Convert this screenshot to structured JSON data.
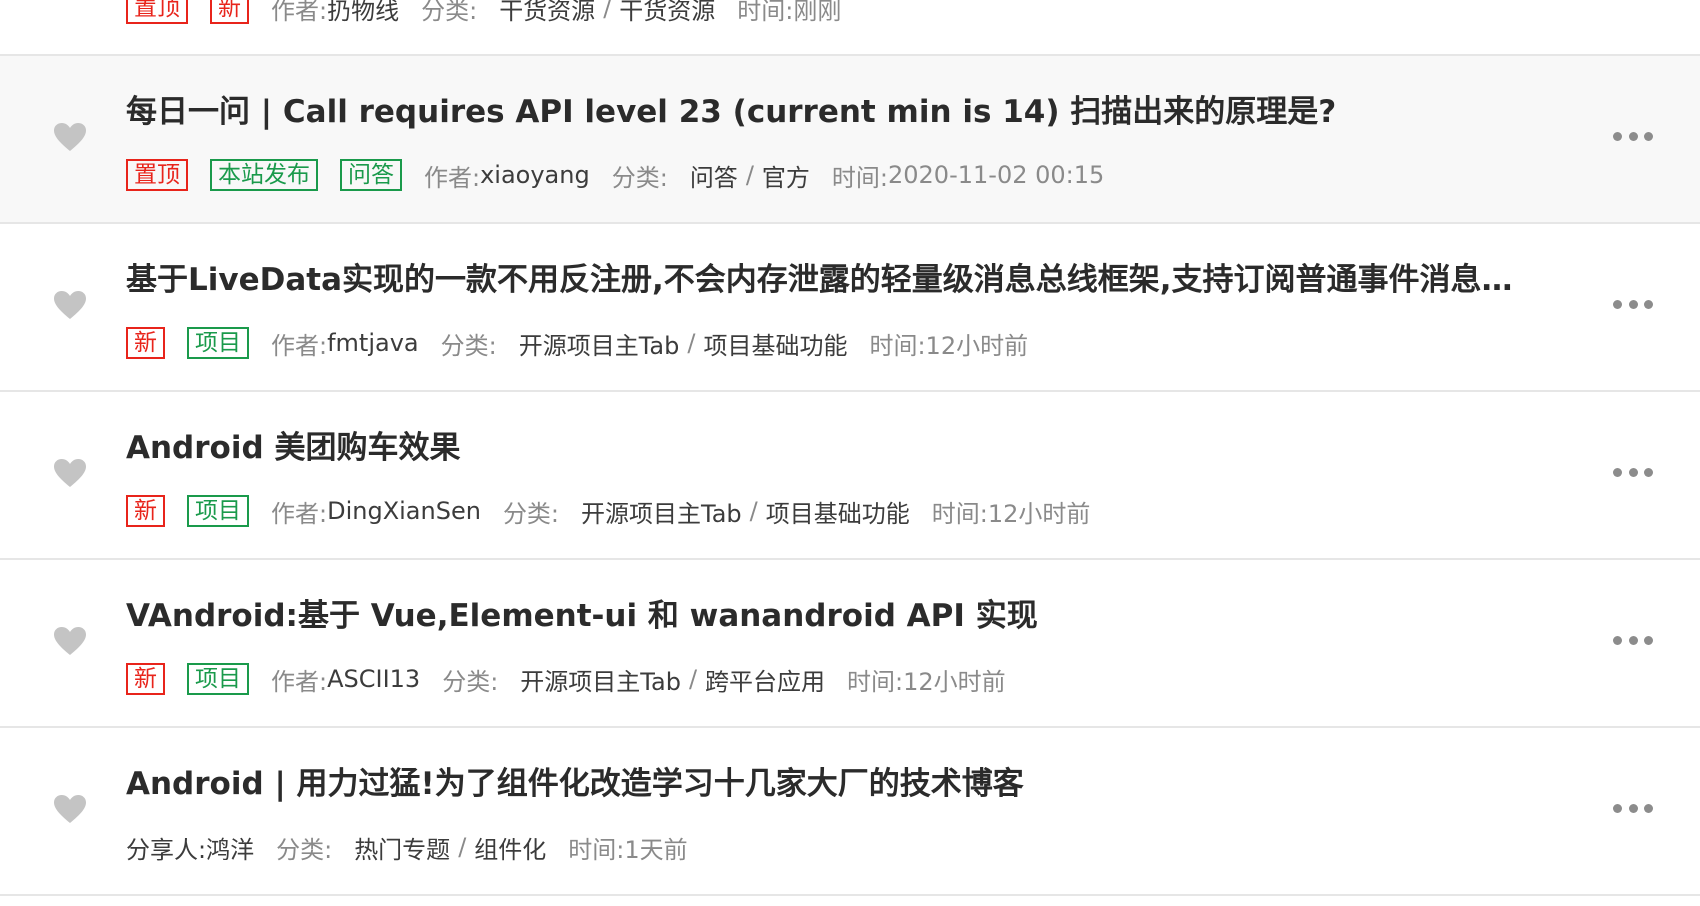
{
  "labels": {
    "author": "作者:",
    "category": "分类:",
    "time": "时间:",
    "sharer": "分享人:",
    "separator": "/"
  },
  "articles": [
    {
      "title": "",
      "tags": [
        {
          "text": "置顶",
          "color": "red"
        },
        {
          "text": "新",
          "color": "red"
        }
      ],
      "author_label": "作者:",
      "author": "扔物线",
      "category_parent": "干货资源",
      "category_child": "干货资源",
      "time": "刚刚",
      "icon": "heart-icon",
      "more_icon": "more-dots-icon"
    },
    {
      "title": "每日一问 | Call requires API level 23 (current min is 14) 扫描出来的原理是?",
      "tags": [
        {
          "text": "置顶",
          "color": "red"
        },
        {
          "text": "本站发布",
          "color": "green"
        },
        {
          "text": "问答",
          "color": "green"
        }
      ],
      "author_label": "作者:",
      "author": "xiaoyang",
      "category_parent": "问答",
      "category_child": "官方",
      "time": "2020-11-02 00:15",
      "icon": "heart-icon",
      "more_icon": "more-dots-icon"
    },
    {
      "title": "基于LiveData实现的一款不用反注册,不会内存泄露的轻量级消息总线框架,支持订阅普通事件消息…",
      "tags": [
        {
          "text": "新",
          "color": "red"
        },
        {
          "text": "项目",
          "color": "green"
        }
      ],
      "author_label": "作者:",
      "author": "fmtjava",
      "category_parent": "开源项目主Tab",
      "category_child": "项目基础功能",
      "time": "12小时前",
      "icon": "heart-icon",
      "more_icon": "more-dots-icon"
    },
    {
      "title": "Android 美团购车效果",
      "tags": [
        {
          "text": "新",
          "color": "red"
        },
        {
          "text": "项目",
          "color": "green"
        }
      ],
      "author_label": "作者:",
      "author": "DingXianSen",
      "category_parent": "开源项目主Tab",
      "category_child": "项目基础功能",
      "time": "12小时前",
      "icon": "heart-icon",
      "more_icon": "more-dots-icon"
    },
    {
      "title": "VAndroid:基于 Vue,Element-ui 和 wanandroid API 实现",
      "tags": [
        {
          "text": "新",
          "color": "red"
        },
        {
          "text": "项目",
          "color": "green"
        }
      ],
      "author_label": "作者:",
      "author": "ASCII13",
      "category_parent": "开源项目主Tab",
      "category_child": "跨平台应用",
      "time": "12小时前",
      "icon": "heart-icon",
      "more_icon": "more-dots-icon"
    },
    {
      "title": "Android | 用力过猛!为了组件化改造学习十几家大厂的技术博客",
      "tags": [],
      "author_label": "分享人:",
      "author": "鸿洋",
      "category_parent": "热门专题",
      "category_child": "组件化",
      "time": "1天前",
      "icon": "heart-icon",
      "more_icon": "more-dots-icon"
    }
  ],
  "colors": {
    "tag_red": "#e8241b",
    "tag_green": "#1a9a4b",
    "title": "#2b2b2b",
    "meta_label": "#8a8a8a",
    "meta_value": "#3c3c3c",
    "row_highlight": "#f8f8f8",
    "divider": "#e6e6e6"
  }
}
